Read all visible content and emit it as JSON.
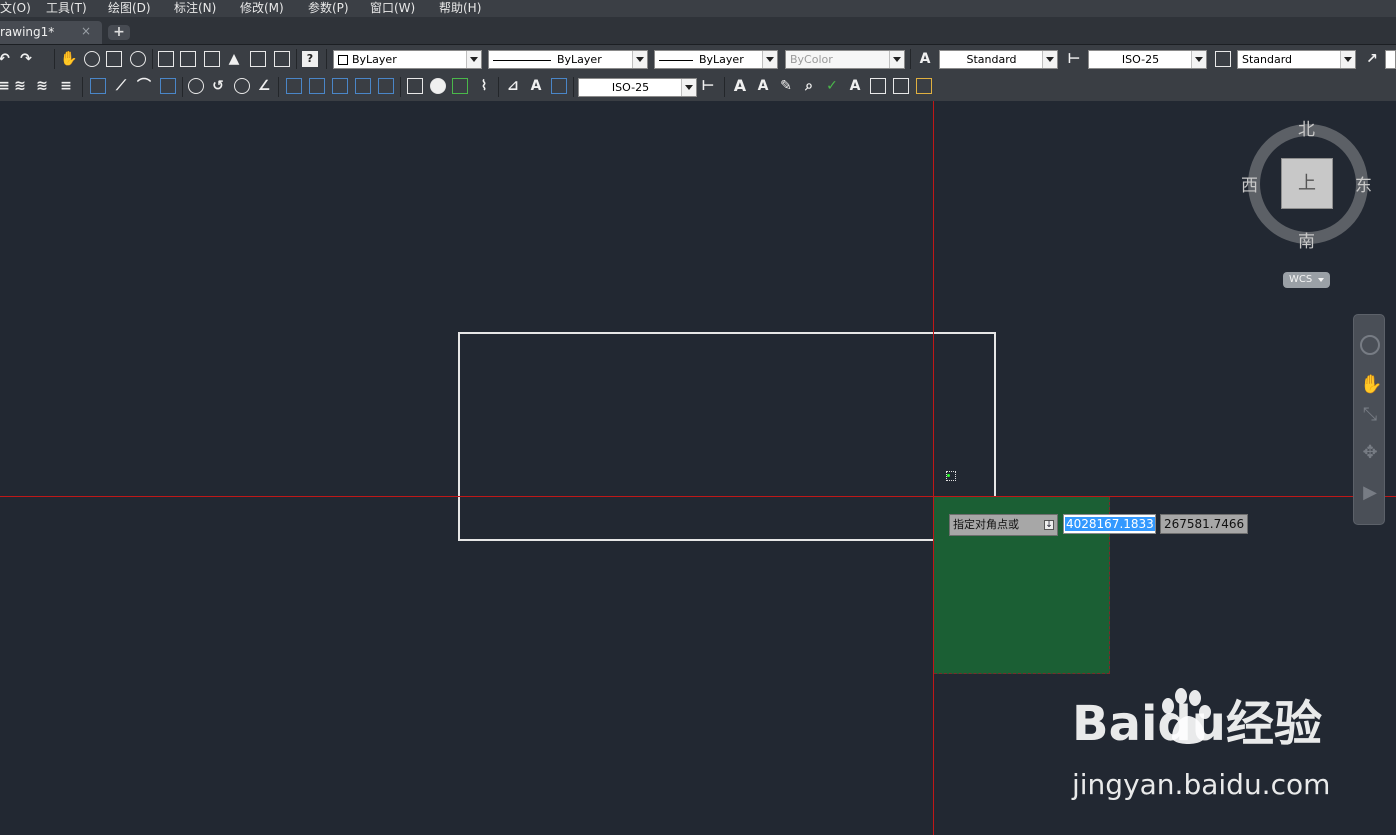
{
  "menubar": {
    "items": [
      "文(O)",
      "工具(T)",
      "绘图(D)",
      "标注(N)",
      "修改(M)",
      "参数(P)",
      "窗口(W)",
      "帮助(H)"
    ]
  },
  "tabs": {
    "active_label": "rawing1*",
    "close_glyph": "×",
    "new_tab_glyph": "+"
  },
  "properties_toolbar": {
    "layer_color": "ByLayer",
    "linetype": "ByLayer",
    "lineweight": "ByLayer",
    "plot_style": "ByColor",
    "text_style": "Standard",
    "dim_style": "ISO-25",
    "table_style": "Standard"
  },
  "dimension_toolbar": {
    "dim_style": "ISO-25"
  },
  "dynamic_input": {
    "prompt": "指定对角点或",
    "x_value": "4028167.1833",
    "y_value": "267581.7466"
  },
  "viewcube": {
    "north": "北",
    "south": "南",
    "east": "东",
    "west": "西",
    "face": "上",
    "wcs_label": "WCS"
  },
  "navbar": {
    "icons": [
      "steering-wheel-icon",
      "pan-icon",
      "zoom-icon",
      "orbit-icon",
      "showmotion-icon"
    ]
  },
  "watermark": {
    "brand": "Baidu经验",
    "url": "jingyan.baidu.com"
  },
  "colors": {
    "canvas": "#222832",
    "crosshair": "#c01818",
    "selection_window": "#1b5f34",
    "selected_text": "#3399ff"
  }
}
